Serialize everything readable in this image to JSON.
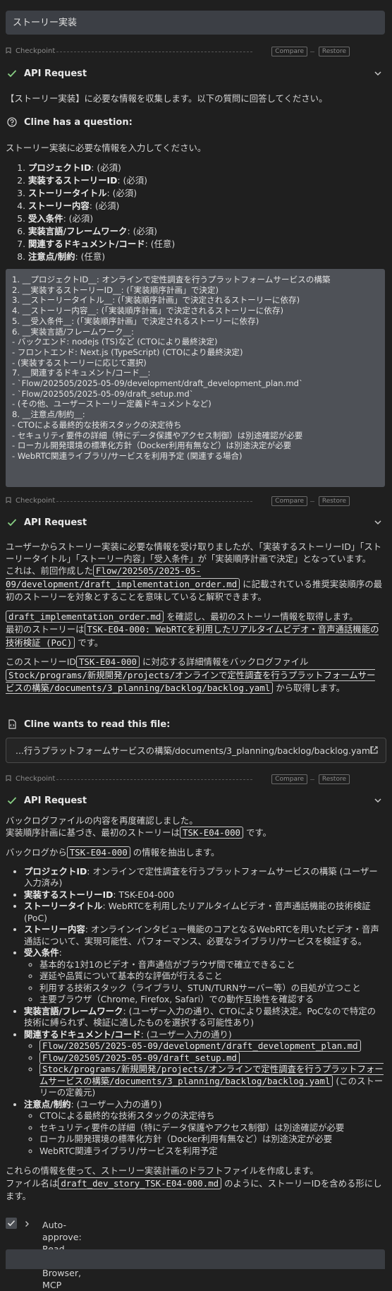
{
  "task_input": "ストーリー実装",
  "checkpoint": {
    "label": "Checkpoint",
    "compare": "Compare",
    "restore": "Restore"
  },
  "api_request_label": "API Request",
  "req1_text": "【ストーリー実装】に必要な情報を収集します。以下の質問に回答してください。",
  "question_title": "Cline has a question:",
  "question_intro": "ストーリー実装に必要な情報を入力してください。",
  "question_items": [
    {
      "bold": "プロジェクトID",
      "rest": ": (必須)"
    },
    {
      "bold": "実装するストーリーID",
      "rest": ": (必須)"
    },
    {
      "bold": "ストーリータイトル",
      "rest": ": (必須)"
    },
    {
      "bold": "ストーリー内容",
      "rest": ": (必須)"
    },
    {
      "bold": "受入条件",
      "rest": ": (必須)"
    },
    {
      "bold": "実装言語/フレームワーク",
      "rest": ": (必須)"
    },
    {
      "bold": "関連するドキュメント/コード",
      "rest": ": (任意)"
    },
    {
      "bold": "注意点/制約",
      "rest": ": (任意)"
    }
  ],
  "answer_lines": [
    "1. __プロジェクトID__: オンラインで定性調査を行うプラットフォームサービスの構築",
    "2. __実装するストーリーID__: (「実装順序計画」で決定)",
    "3. __ストーリータイトル__: (「実装順序計画」で決定されるストーリーに依存)",
    "4. __ストーリー内容__: (「実装順序計画」で決定されるストーリーに依存)",
    "5. __受入条件__: (「実装順序計画」で決定されるストーリーに依存)",
    "6. __実装言語/フレームワーク__:",
    "- バックエンド: nodejs (TS)など (CTOにより最終決定)",
    "- フロントエンド: Next.js (TypeScript) (CTOにより最終決定)",
    "- (実装するストーリーに応じて選択)",
    "7. __関連するドキュメント/コード__:",
    "- `Flow/202505/2025-05-09/development/draft_development_plan.md`",
    "- `Flow/202505/2025-05-09/draft_setup.md`",
    "- (その他、ユーザーストーリー定義ドキュメントなど)",
    "8. __注意点/制約__:",
    "- CTOによる最終的な技術スタックの決定待ち",
    "- セキュリティ要件の詳細（特にデータ保護やアクセス制御）は別途確認が必要",
    "- ローカル開発環境の標準化方針（Docker利用有無など）は別途決定が必要",
    "- WebRTC関連ライブラリ/サービスを利用予定 (関連する場合)"
  ],
  "req2": {
    "p1": "ユーザーからストーリー実装に必要な情報を受け取りましたが、「実装するストーリーID」「ストーリータイトル」「ストーリー内容」「受入条件」が「実装順序計画で決定」となっています。",
    "p2a": "これは、前回作成した",
    "p2code": "Flow/202505/2025-05-09/development/draft_implementation_order.md",
    "p2b": "に記載されている推奨実装順序の最初のストーリーを対象とすることを意味していると解釈できます。",
    "p3code": "draft_implementation_order.md",
    "p3a": "を確認し、最初のストーリー情報を取得します。",
    "p3b": "最初のストーリーは",
    "p3code2": "TSK-E04-000: WebRTCを利用したリアルタイムビデオ・音声通話機能の技術検証 (PoC)",
    "p3c": "です。",
    "p4a": "このストーリーID",
    "p4code": "TSK-E04-000",
    "p4b": "に対応する詳細情報をバックログファイル",
    "p4code2": "Stock/programs/新規開発/projects/オンラインで定性調査を行うプラットフォームサービスの構築/documents/3_planning/backlog/backlog.yaml",
    "p4c": "から取得します。"
  },
  "read_title": "Cline wants to read this file:",
  "read_path": "...行うプラットフォームサービスの構築/documents/3_planning/backlog/backlog.yaml",
  "req3": {
    "p1": "バックログファイルの内容を再度確認しました。",
    "p2a": "実装順序計画に基づき、最初のストーリーは",
    "p2code": "TSK-E04-000",
    "p2b": "です。",
    "p3a": "バックログから",
    "p3code": "TSK-E04-000",
    "p3b": "の情報を抽出します。",
    "items": {
      "pid_b": "プロジェクトID",
      "pid": ": オンラインで定性調査を行うプラットフォームサービスの構築 (ユーザー入力済み)",
      "sid_b": "実装するストーリーID",
      "sid": ": TSK-E04-000",
      "st_b": "ストーリータイトル",
      "st": ": WebRTCを利用したリアルタイムビデオ・音声通話機能の技術検証 (PoC)",
      "sc_b": "ストーリー内容",
      "sc": ": オンラインインタビュー機能のコアとなるWebRTCを用いたビデオ・音声通話について、実現可能性、パフォーマンス、必要なライブラリ/サービスを検証する。",
      "ac_b": "受入条件",
      "ac": ":",
      "ac_list": [
        "基本的な1対1のビデオ・音声通信がブラウザ間で確立できること",
        "遅延や品質について基本的な評価が行えること",
        "利用する技術スタック（ライブラリ、STUN/TURNサーバー等）の目処が立つこと",
        "主要ブラウザ（Chrome, Firefox, Safari）での動作互換性を確認する"
      ],
      "lang_b": "実装言語/フレームワーク",
      "lang": ": (ユーザー入力の通り、CTOにより最終決定。PoCなので特定の技術に縛られず、検証に適したものを選択する可能性あり)",
      "docs_b": "関連するドキュメント/コード",
      "docs": ": (ユーザー入力の通り)",
      "doc1": "Flow/202505/2025-05-09/development/draft_development_plan.md",
      "doc2": "Flow/202505/2025-05-09/draft_setup.md",
      "doc3": "Stock/programs/新規開発/projects/オンラインで定性調査を行うプラットフォームサービスの構築/documents/3_planning/backlog/backlog.yaml",
      "doc3_note": "(このストーリーの定義元)",
      "note_b": "注意点/制約",
      "note": ": (ユーザー入力の通り)",
      "note_list": [
        "CTOによる最終的な技術スタックの決定待ち",
        "セキュリティ要件の詳細（特にデータ保護やアクセス制御）は別途確認が必要",
        "ローカル開発環境の標準化方針（Docker利用有無など）は別途決定が必要",
        "WebRTC関連ライブラリ/サービスを利用予定"
      ]
    },
    "p4": "これらの情報を使って、ストーリー実装計画のドラフトファイルを作成します。",
    "p5a": "ファイル名は",
    "p5code": "draft_dev_story_TSK-E04-000.md",
    "p5b": "のように、ストーリーIDを含める形にします。"
  },
  "auto_approve": "Auto-approve: Read, Edit, Browser, MCP",
  "icons": {
    "check": "check-icon",
    "chevron": "chevron-down-icon",
    "flag": "flag-icon",
    "question": "question-circle-icon",
    "file": "file-code-icon",
    "external": "external-link-icon"
  },
  "colors": {
    "accent_check": "#89d185",
    "bg": "#1f1f1f",
    "answer_bg": "#4e5157"
  }
}
